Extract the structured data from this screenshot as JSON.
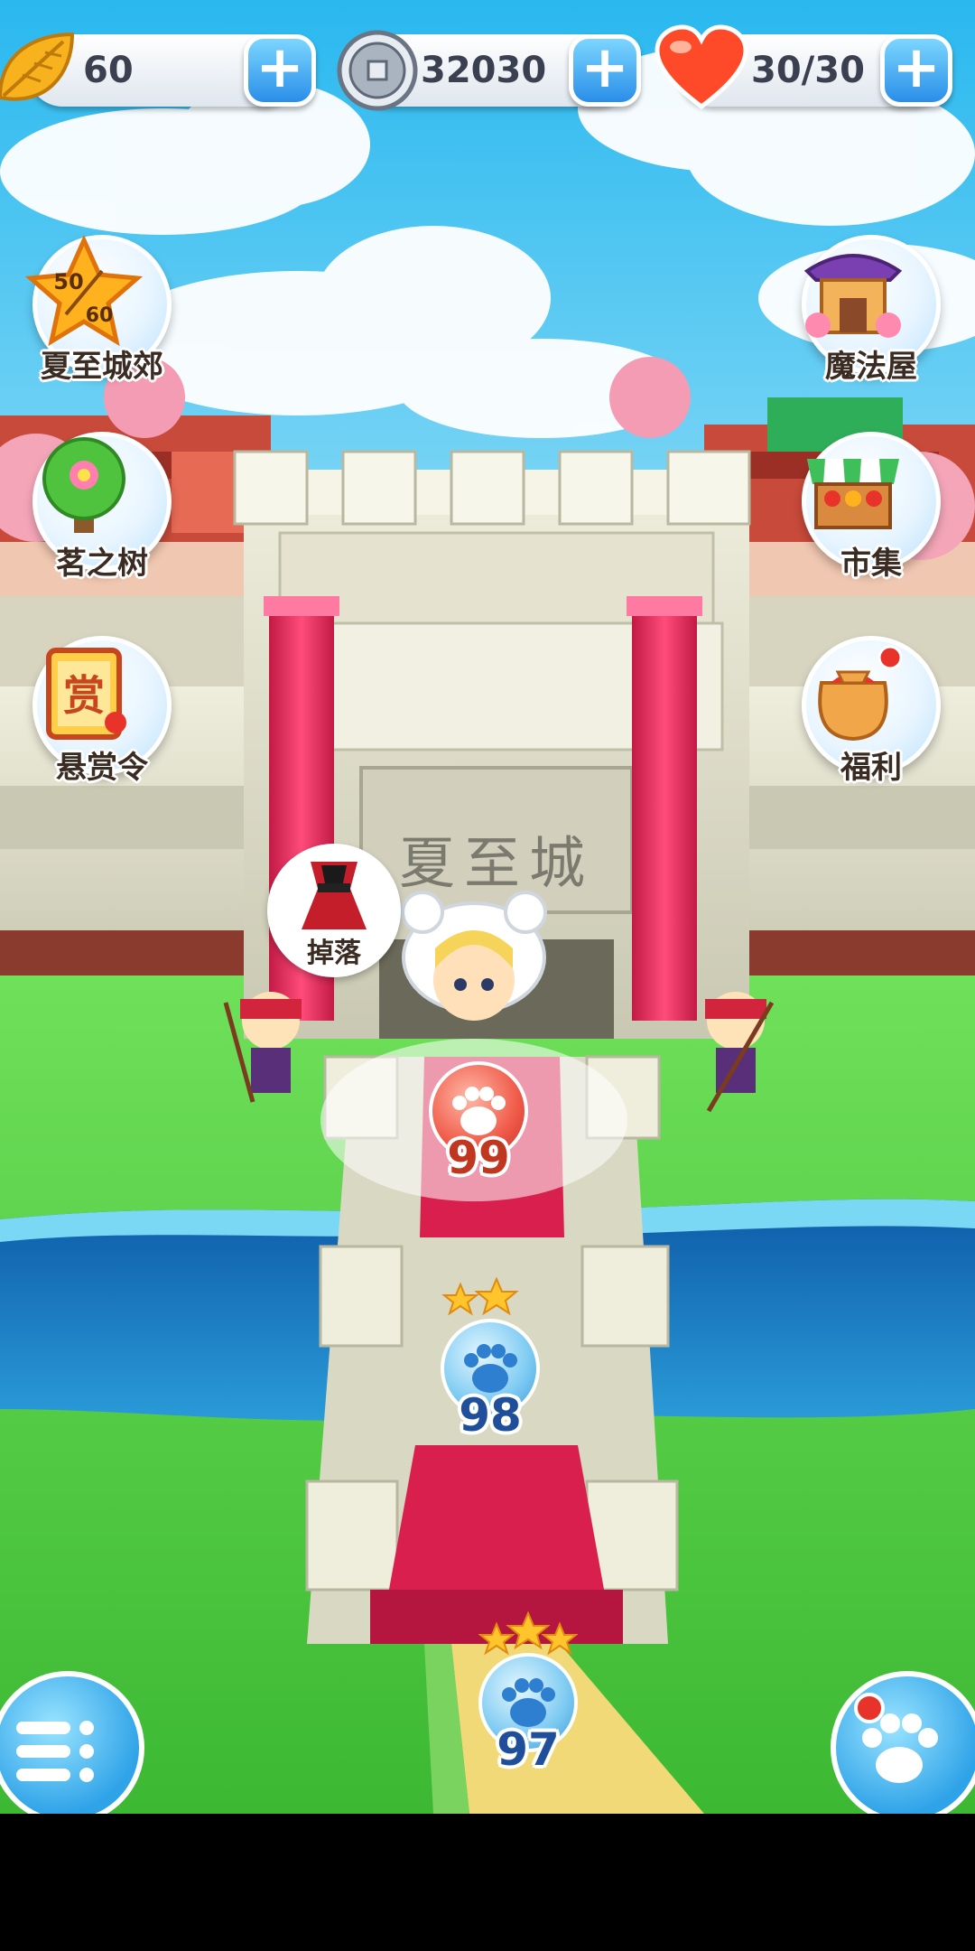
{
  "resources": {
    "leaves": {
      "value": "60",
      "icon": "golden-leaf-icon"
    },
    "coins": {
      "value": "32030",
      "icon": "silver-coin-icon"
    },
    "hearts": {
      "value": "30/30",
      "icon": "heart-icon"
    },
    "plus_symbol": "+"
  },
  "left_menu": [
    {
      "label": "夏至城郊",
      "badge_top": "50",
      "badge_bottom": "60",
      "icon": "star-badge-icon"
    },
    {
      "label": "茗之树",
      "icon": "tree-icon"
    },
    {
      "label": "悬赏令",
      "badge": "赏",
      "icon": "bounty-scroll-icon"
    }
  ],
  "right_menu": [
    {
      "label": "魔法屋",
      "icon": "magic-house-icon"
    },
    {
      "label": "市集",
      "icon": "market-stall-icon"
    },
    {
      "label": "福利",
      "icon": "gift-bag-icon"
    }
  ],
  "scene": {
    "gate_name": "夏至城",
    "drop_label": "掉落"
  },
  "levels": [
    {
      "number": "99",
      "stars": 0,
      "state": "current"
    },
    {
      "number": "98",
      "stars": 2,
      "state": "cleared"
    },
    {
      "number": "97",
      "stars": 3,
      "state": "cleared"
    }
  ],
  "colors": {
    "sky": "#4fc3f0",
    "grass": "#5bd246",
    "water": "#1f7fc8",
    "stone": "#e3e2cf",
    "banner_red": "#e8335e",
    "plus_blue": "#2a8ee8"
  }
}
